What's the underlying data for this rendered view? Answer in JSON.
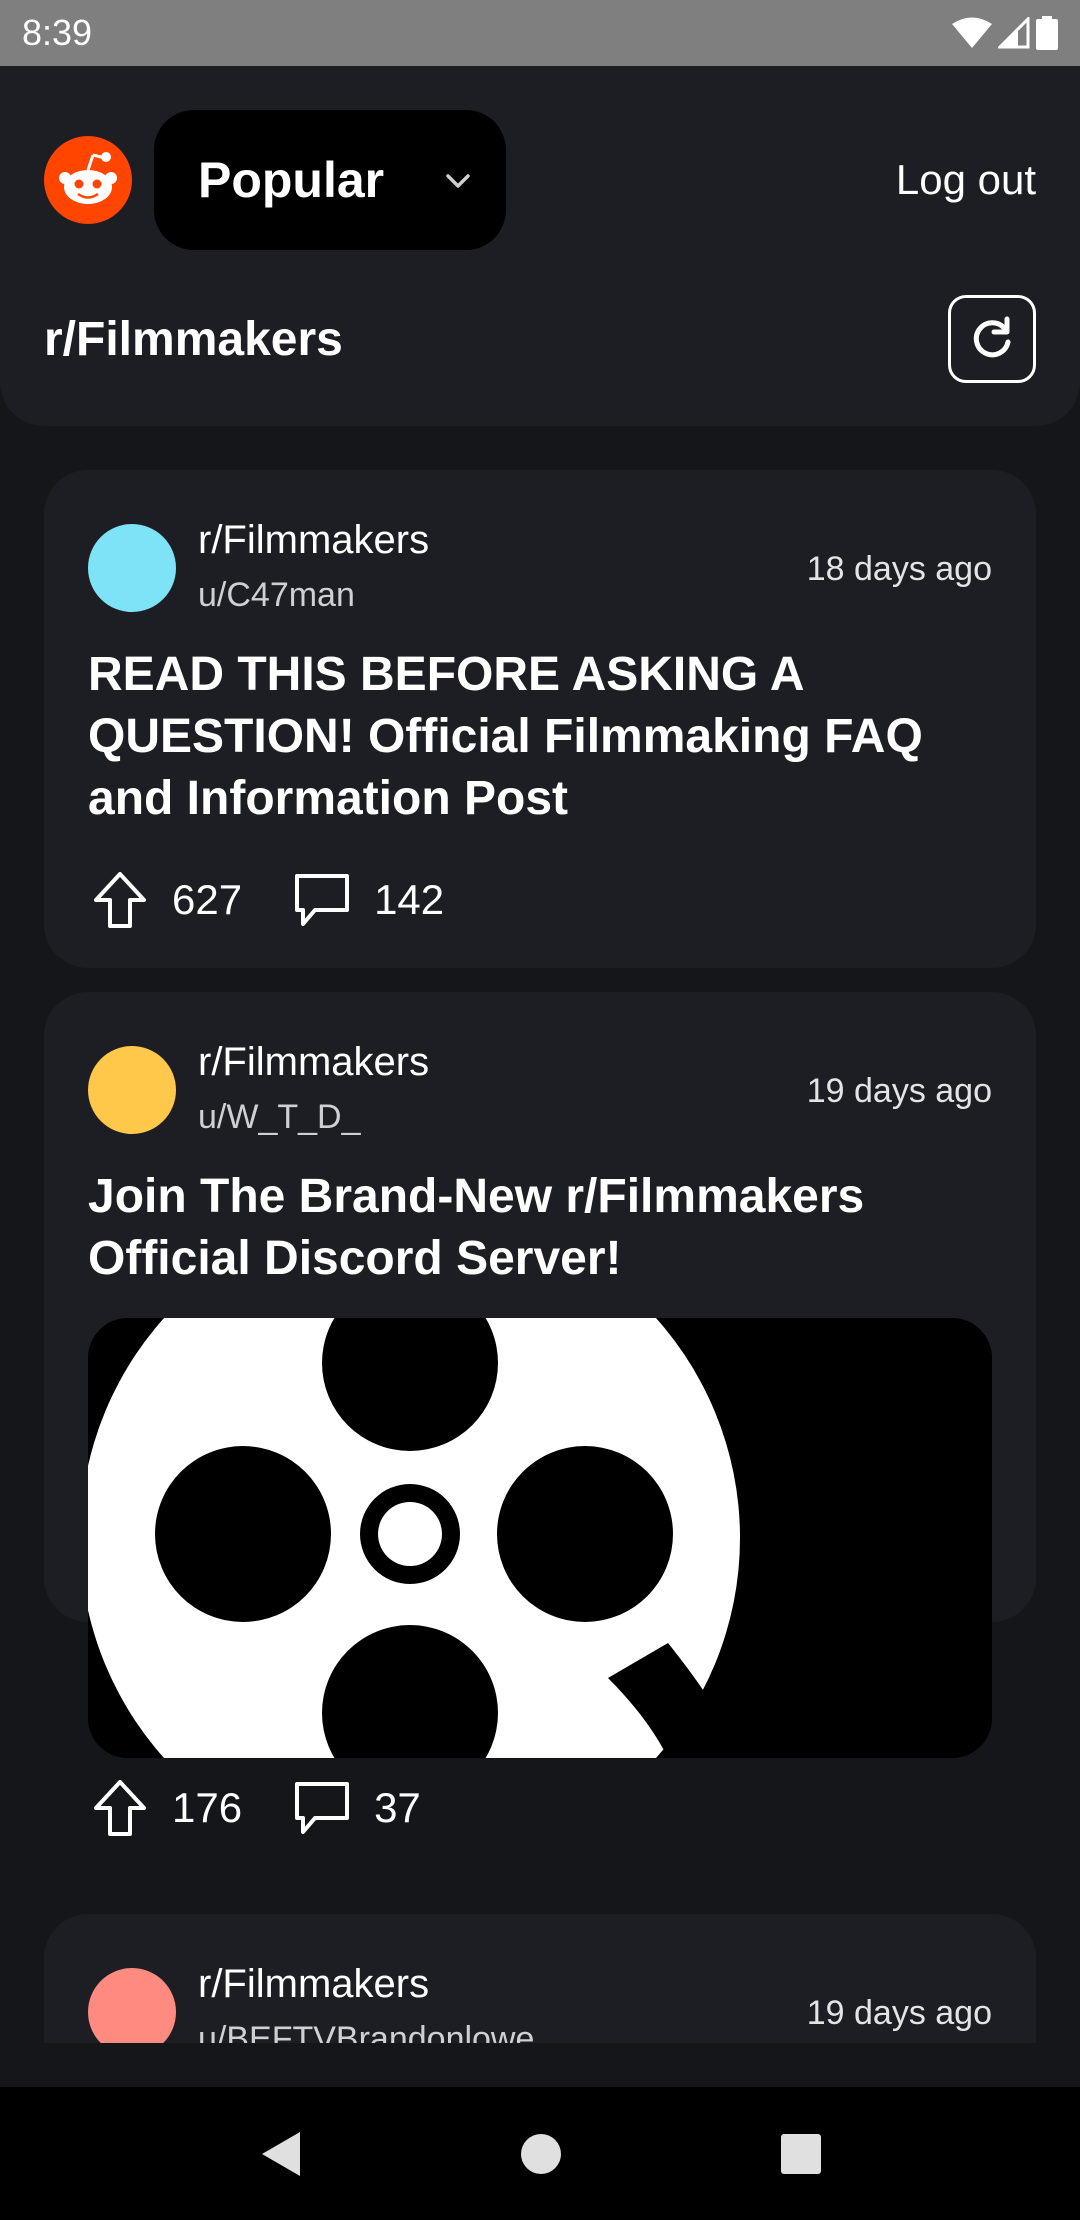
{
  "status_bar": {
    "time": "8:39"
  },
  "header": {
    "feed_label": "Popular",
    "logout_label": "Log out",
    "subreddit_title": "r/Filmmakers"
  },
  "posts": [
    {
      "subreddit": "r/Filmmakers",
      "author": "u/C47man",
      "time": "18 days ago",
      "title": "READ THIS BEFORE ASKING A QUESTION! Official Filmmaking FAQ and Information Post",
      "upvotes": "627",
      "comments": "142",
      "avatar_color": "#7fe3f7"
    },
    {
      "subreddit": "r/Filmmakers",
      "author": "u/W_T_D_",
      "time": "19 days ago",
      "title": "Join The Brand-New r/Filmmakers Official Discord Server!",
      "upvotes": "176",
      "comments": "37",
      "avatar_color": "#ffc84a",
      "image": "film-reel-logo"
    },
    {
      "subreddit": "r/Filmmakers",
      "author": "u/BEFTVBrandonlowe",
      "time": "19 days ago",
      "avatar_color": "#ff8a80"
    }
  ],
  "colors": {
    "brand": "#ff4500",
    "background": "#15161a",
    "card": "#1d1e23"
  },
  "nav": {
    "icons": [
      "back-icon",
      "home-icon",
      "recents-icon"
    ]
  }
}
